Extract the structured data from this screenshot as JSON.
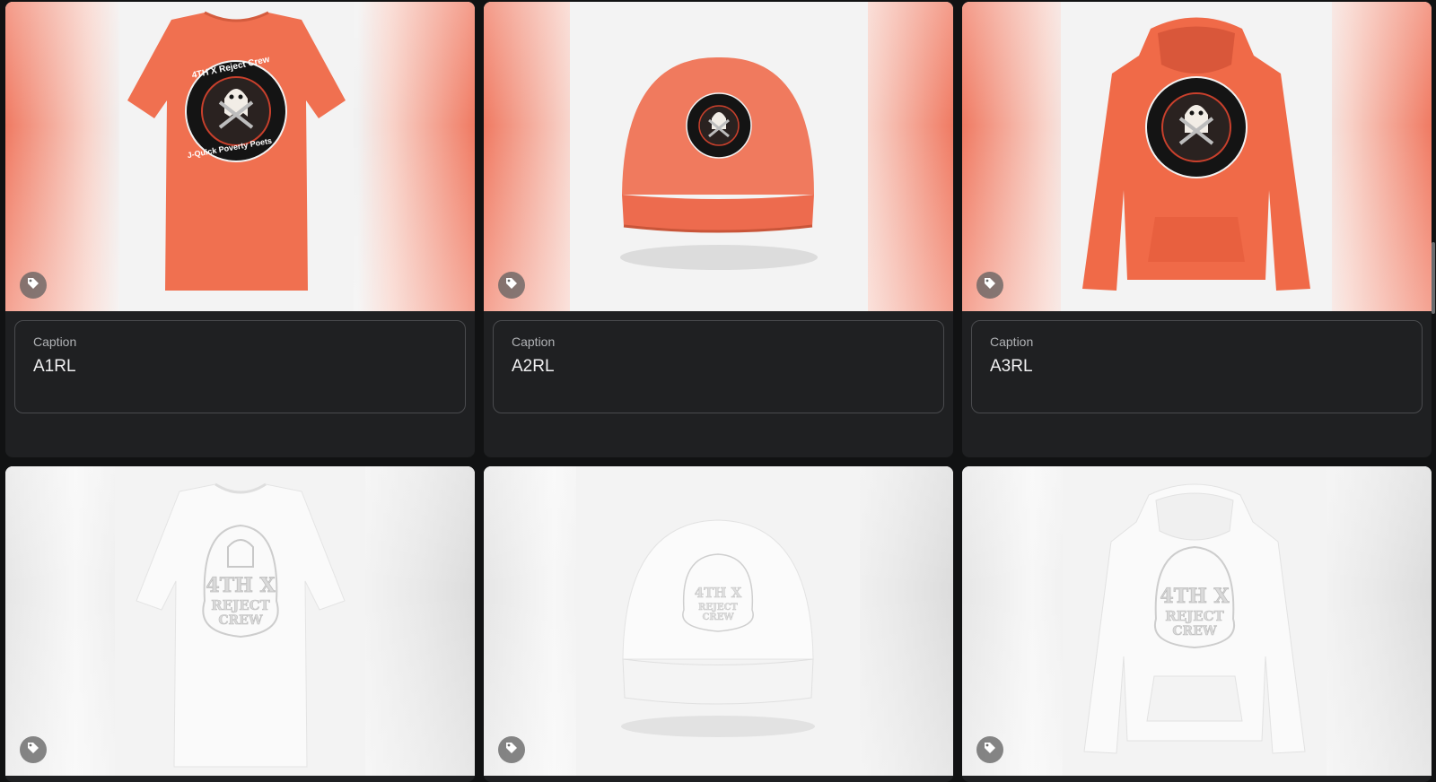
{
  "gallery": {
    "caption_label": "Caption",
    "items": [
      {
        "caption": "A1RL",
        "product": "t-shirt",
        "color": "#f07050"
      },
      {
        "caption": "A2RL",
        "product": "trucker-cap",
        "color": "#f07050"
      },
      {
        "caption": "A3RL",
        "product": "hoodie",
        "color": "#f07050"
      },
      {
        "caption": "",
        "product": "t-shirt",
        "color": "#ffffff"
      },
      {
        "caption": "",
        "product": "trucker-cap",
        "color": "#ffffff"
      },
      {
        "caption": "",
        "product": "hoodie",
        "color": "#ffffff"
      }
    ],
    "logo_text": {
      "arc_top": "4TH X  Reject Crew",
      "arc_bottom": "J-Quick Poverty Poets",
      "embossed_line1": "4TH X",
      "embossed_line2": "REJECT",
      "embossed_line3": "CREW"
    }
  },
  "icons": {
    "tag": "tag-icon"
  },
  "colors": {
    "card_background": "#1f2022",
    "page_background": "#111213",
    "accent_orange": "#f07050"
  }
}
